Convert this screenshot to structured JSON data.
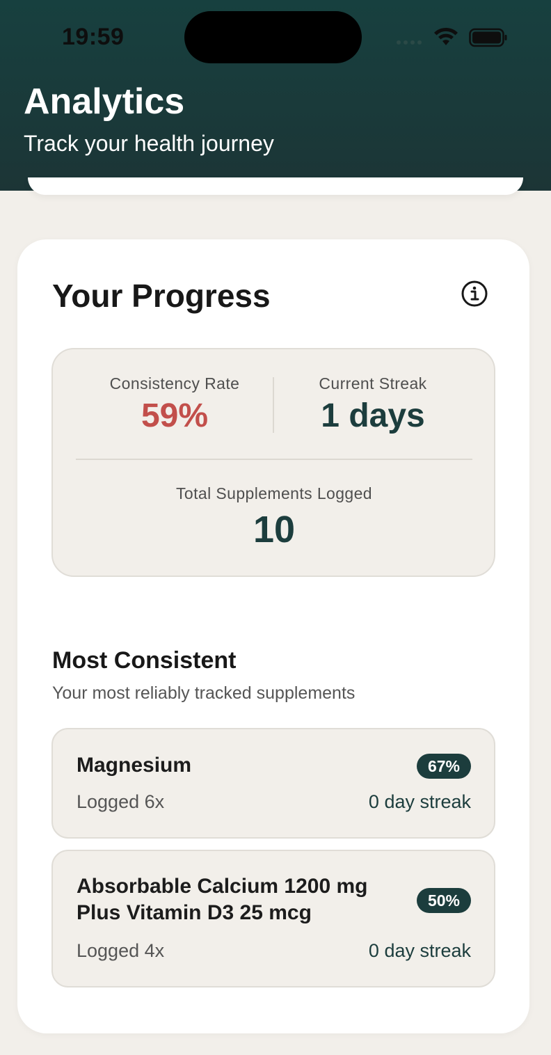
{
  "status_bar": {
    "time": "19:59",
    "icons": [
      "signal-dots-icon",
      "wifi-icon",
      "battery-icon"
    ]
  },
  "header": {
    "title": "Analytics",
    "subtitle": "Track your health journey"
  },
  "progress": {
    "title": "Your Progress",
    "info_icon": "info-icon",
    "consistency_label": "Consistency Rate",
    "consistency_value": "59%",
    "streak_label": "Current Streak",
    "streak_value": "1 days",
    "total_label": "Total Supplements Logged",
    "total_value": "10"
  },
  "most_consistent": {
    "title": "Most Consistent",
    "subtitle": "Your most reliably tracked supplements",
    "items": [
      {
        "name": "Magnesium",
        "percent": "67%",
        "logged": "Logged 6x",
        "streak": "0 day streak"
      },
      {
        "name": "Absorbable Calcium 1200 mg Plus Vitamin D3 25 mcg",
        "percent": "50%",
        "logged": "Logged 4x",
        "streak": "0 day streak"
      }
    ]
  },
  "colors": {
    "header_bg": "#1c3536",
    "accent_dark_teal": "#1c3d3d",
    "consistency_red": "#c24f4b",
    "page_bg": "#f2efea"
  }
}
